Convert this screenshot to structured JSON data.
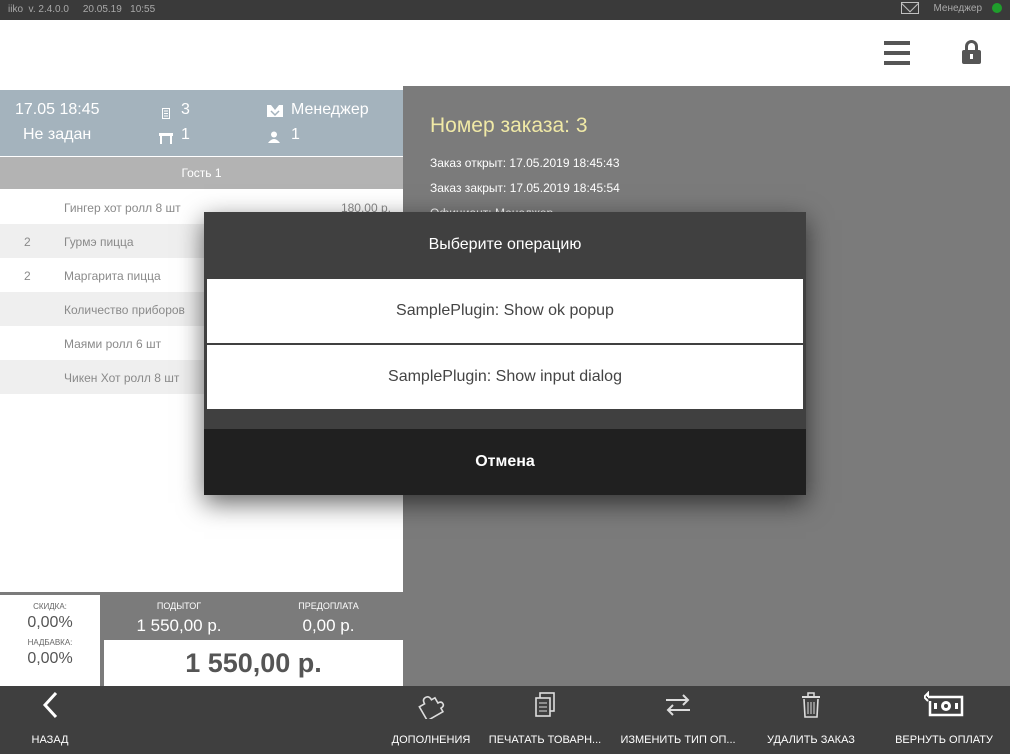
{
  "statusbar": {
    "app": "iiko  v. 2.4.0.0",
    "date": "20.05.19",
    "time": "10:55",
    "user": "Менеджер"
  },
  "order_info": {
    "datetime": "17.05 18:45",
    "table_status": "Не задан",
    "order_num": "3",
    "table_num": "1",
    "waiter": "Менеджер",
    "guests": "1"
  },
  "guest_bar": "Гость 1",
  "items": [
    {
      "qty": "",
      "name": "Гингер хот ролл 8 шт",
      "price": "180,00 р."
    },
    {
      "qty": "2",
      "name": "Гурмэ пицца",
      "price": ""
    },
    {
      "qty": "2",
      "name": "Маргарита пицца",
      "price": ""
    },
    {
      "qty": "",
      "name": "Количество приборов",
      "price": ""
    },
    {
      "qty": "",
      "name": "Маями ролл 6 шт",
      "price": ""
    },
    {
      "qty": "",
      "name": "Чикен Хот ролл 8 шт",
      "price": ""
    }
  ],
  "totals": {
    "discount_label": "СКИДКА:",
    "discount": "0,00%",
    "markup_label": "НАДБАВКА:",
    "markup": "0,00%",
    "subtotal_label": "ПОДЫТОГ",
    "subtotal": "1 550,00 р.",
    "prepay_label": "ПРЕДОПЛАТА",
    "prepay": "0,00 р.",
    "grand": "1 550,00 р."
  },
  "order_details": {
    "title": "Номер заказа: 3",
    "opened": "Заказ открыт: 17.05.2019 18:45:43",
    "closed": "Заказ закрыт: 17.05.2019 18:45:54",
    "waiter": "Официант: Менеджер"
  },
  "footer": {
    "back": "НАЗАД",
    "addons": "ДОПОЛНЕНИЯ",
    "print": "ПЕЧАТАТЬ ТОВАРН...",
    "change_pay": "ИЗМЕНИТЬ ТИП ОП...",
    "delete": "УДАЛИТЬ ЗАКАЗ",
    "refund": "ВЕРНУТЬ ОПЛАТУ"
  },
  "modal": {
    "title": "Выберите операцию",
    "options": [
      "SamplePlugin: Show ok popup",
      "SamplePlugin: Show input dialog"
    ],
    "cancel": "Отмена"
  }
}
